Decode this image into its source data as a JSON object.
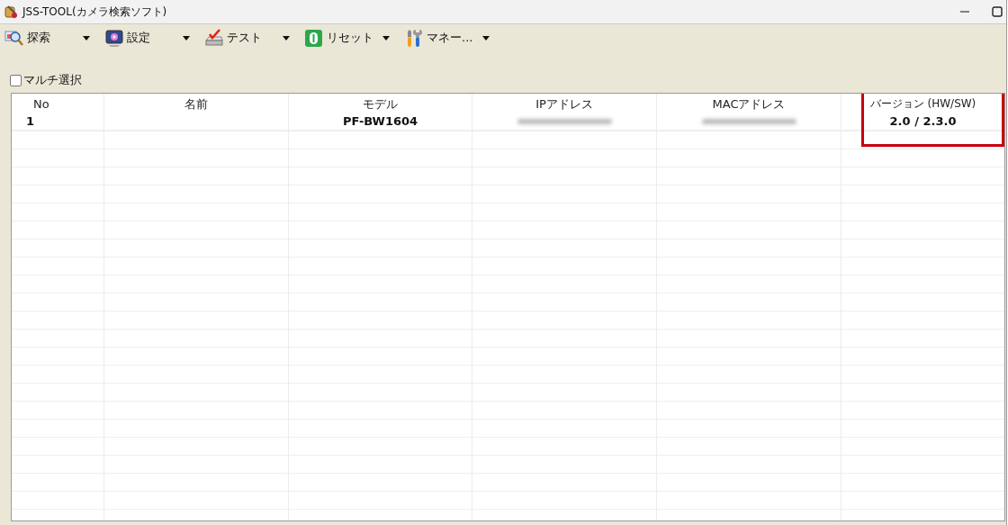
{
  "window": {
    "title": "JSS-TOOL(カメラ検索ソフト)"
  },
  "toolbar": [
    {
      "kind": "search",
      "label": "探索"
    },
    {
      "kind": "settings",
      "label": "設定"
    },
    {
      "kind": "test",
      "label": "テスト"
    },
    {
      "kind": "reset",
      "label": "リセット"
    },
    {
      "kind": "tools",
      "label": "マネー..."
    }
  ],
  "multi_select": {
    "label": "マルチ選択",
    "checked": false
  },
  "table": {
    "columns": [
      {
        "label": "No",
        "highlighted": false
      },
      {
        "label": "名前",
        "highlighted": false
      },
      {
        "label": "モデル",
        "highlighted": false
      },
      {
        "label": "IPアドレス",
        "highlighted": false
      },
      {
        "label": "MACアドレス",
        "highlighted": false
      },
      {
        "label": "バージョン (HW/SW)",
        "highlighted": true
      }
    ],
    "rows": [
      [
        {
          "text": "1"
        },
        {
          "text": ""
        },
        {
          "text": "PF-BW1604"
        },
        {
          "redacted": true
        },
        {
          "redacted": true
        },
        {
          "text": "2.0 / 2.3.0"
        }
      ]
    ]
  }
}
